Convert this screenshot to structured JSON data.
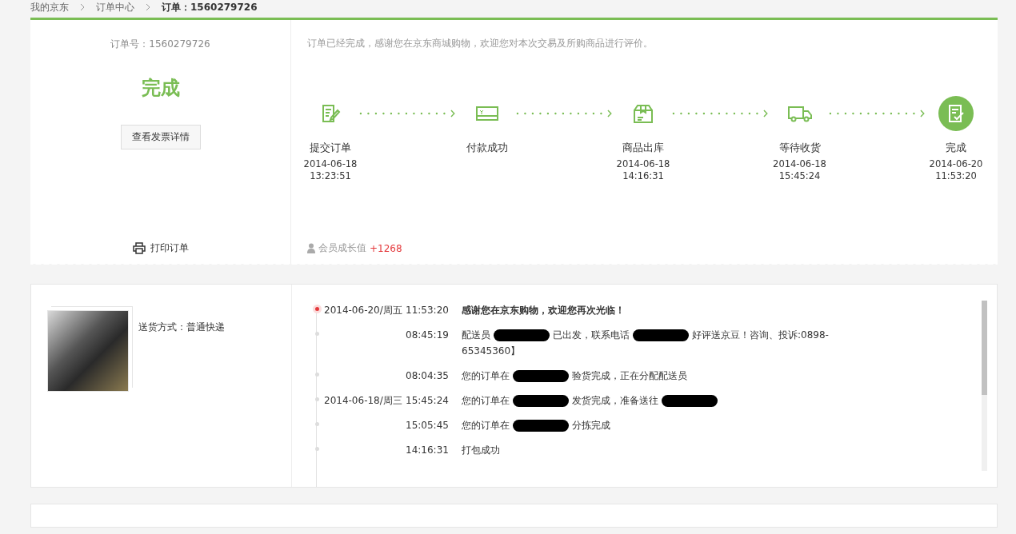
{
  "breadcrumb": [
    {
      "label": "我的京东",
      "current": false
    },
    {
      "label": "订单中心",
      "current": false
    },
    {
      "label": "订单：1560279726",
      "current": true
    }
  ],
  "order": {
    "number": "订单号：1560279726",
    "status": "完成",
    "invoice_button": "查看发票详情",
    "print_link": "打印订单"
  },
  "progress": {
    "message": "订单已经完成，感谢您在京东商城购物，欢迎您对本次交易及所购商品进行评价。",
    "steps": [
      {
        "kind": "submit",
        "label": "提交订单",
        "date": "2014-06-18",
        "time": "13:23:51",
        "current": false
      },
      {
        "kind": "pay",
        "label": "付款成功",
        "current": false
      },
      {
        "kind": "outbound",
        "label": "商品出库",
        "date": "2014-06-18",
        "time": "14:16:31",
        "current": false
      },
      {
        "kind": "delivery",
        "label": "等待收货",
        "date": "2014-06-18",
        "time": "15:45:24",
        "current": false
      },
      {
        "kind": "done",
        "label": "完成",
        "date": "2014-06-20",
        "time": "11:53:20",
        "current": true
      }
    ],
    "growth_label": "会员成长值",
    "growth_value": "+1268"
  },
  "shipment": {
    "method": "送货方式：普通快递",
    "events": [
      {
        "date": "2014-06-20/周五",
        "time": "11:53:20",
        "latest": true,
        "segments": [
          {
            "kind": "text",
            "text": "感谢您在京东购物，欢迎您再次光临！"
          }
        ]
      },
      {
        "time": "08:45:19",
        "latest": false,
        "segments": [
          {
            "kind": "text",
            "text": "配送员"
          },
          {
            "kind": "redaction"
          },
          {
            "kind": "text",
            "text": "已出发，联系电话"
          },
          {
            "kind": "redaction"
          },
          {
            "kind": "text",
            "text": "好评送京豆！咨询、投诉:0898-65345360】"
          }
        ]
      },
      {
        "time": "08:04:35",
        "latest": false,
        "segments": [
          {
            "kind": "text",
            "text": "您的订单在"
          },
          {
            "kind": "redaction"
          },
          {
            "kind": "text",
            "text": "验货完成，正在分配配送员"
          }
        ]
      },
      {
        "date": "2014-06-18/周三",
        "time": "15:45:24",
        "latest": false,
        "segments": [
          {
            "kind": "text",
            "text": "您的订单在"
          },
          {
            "kind": "redaction"
          },
          {
            "kind": "text",
            "text": "发货完成，准备送往"
          },
          {
            "kind": "redaction"
          }
        ]
      },
      {
        "time": "15:05:45",
        "latest": false,
        "segments": [
          {
            "kind": "text",
            "text": "您的订单在"
          },
          {
            "kind": "redaction"
          },
          {
            "kind": "text",
            "text": "分拣完成"
          }
        ]
      },
      {
        "time": "14:16:31",
        "latest": false,
        "segments": [
          {
            "kind": "text",
            "text": "打包成功"
          }
        ]
      }
    ]
  }
}
